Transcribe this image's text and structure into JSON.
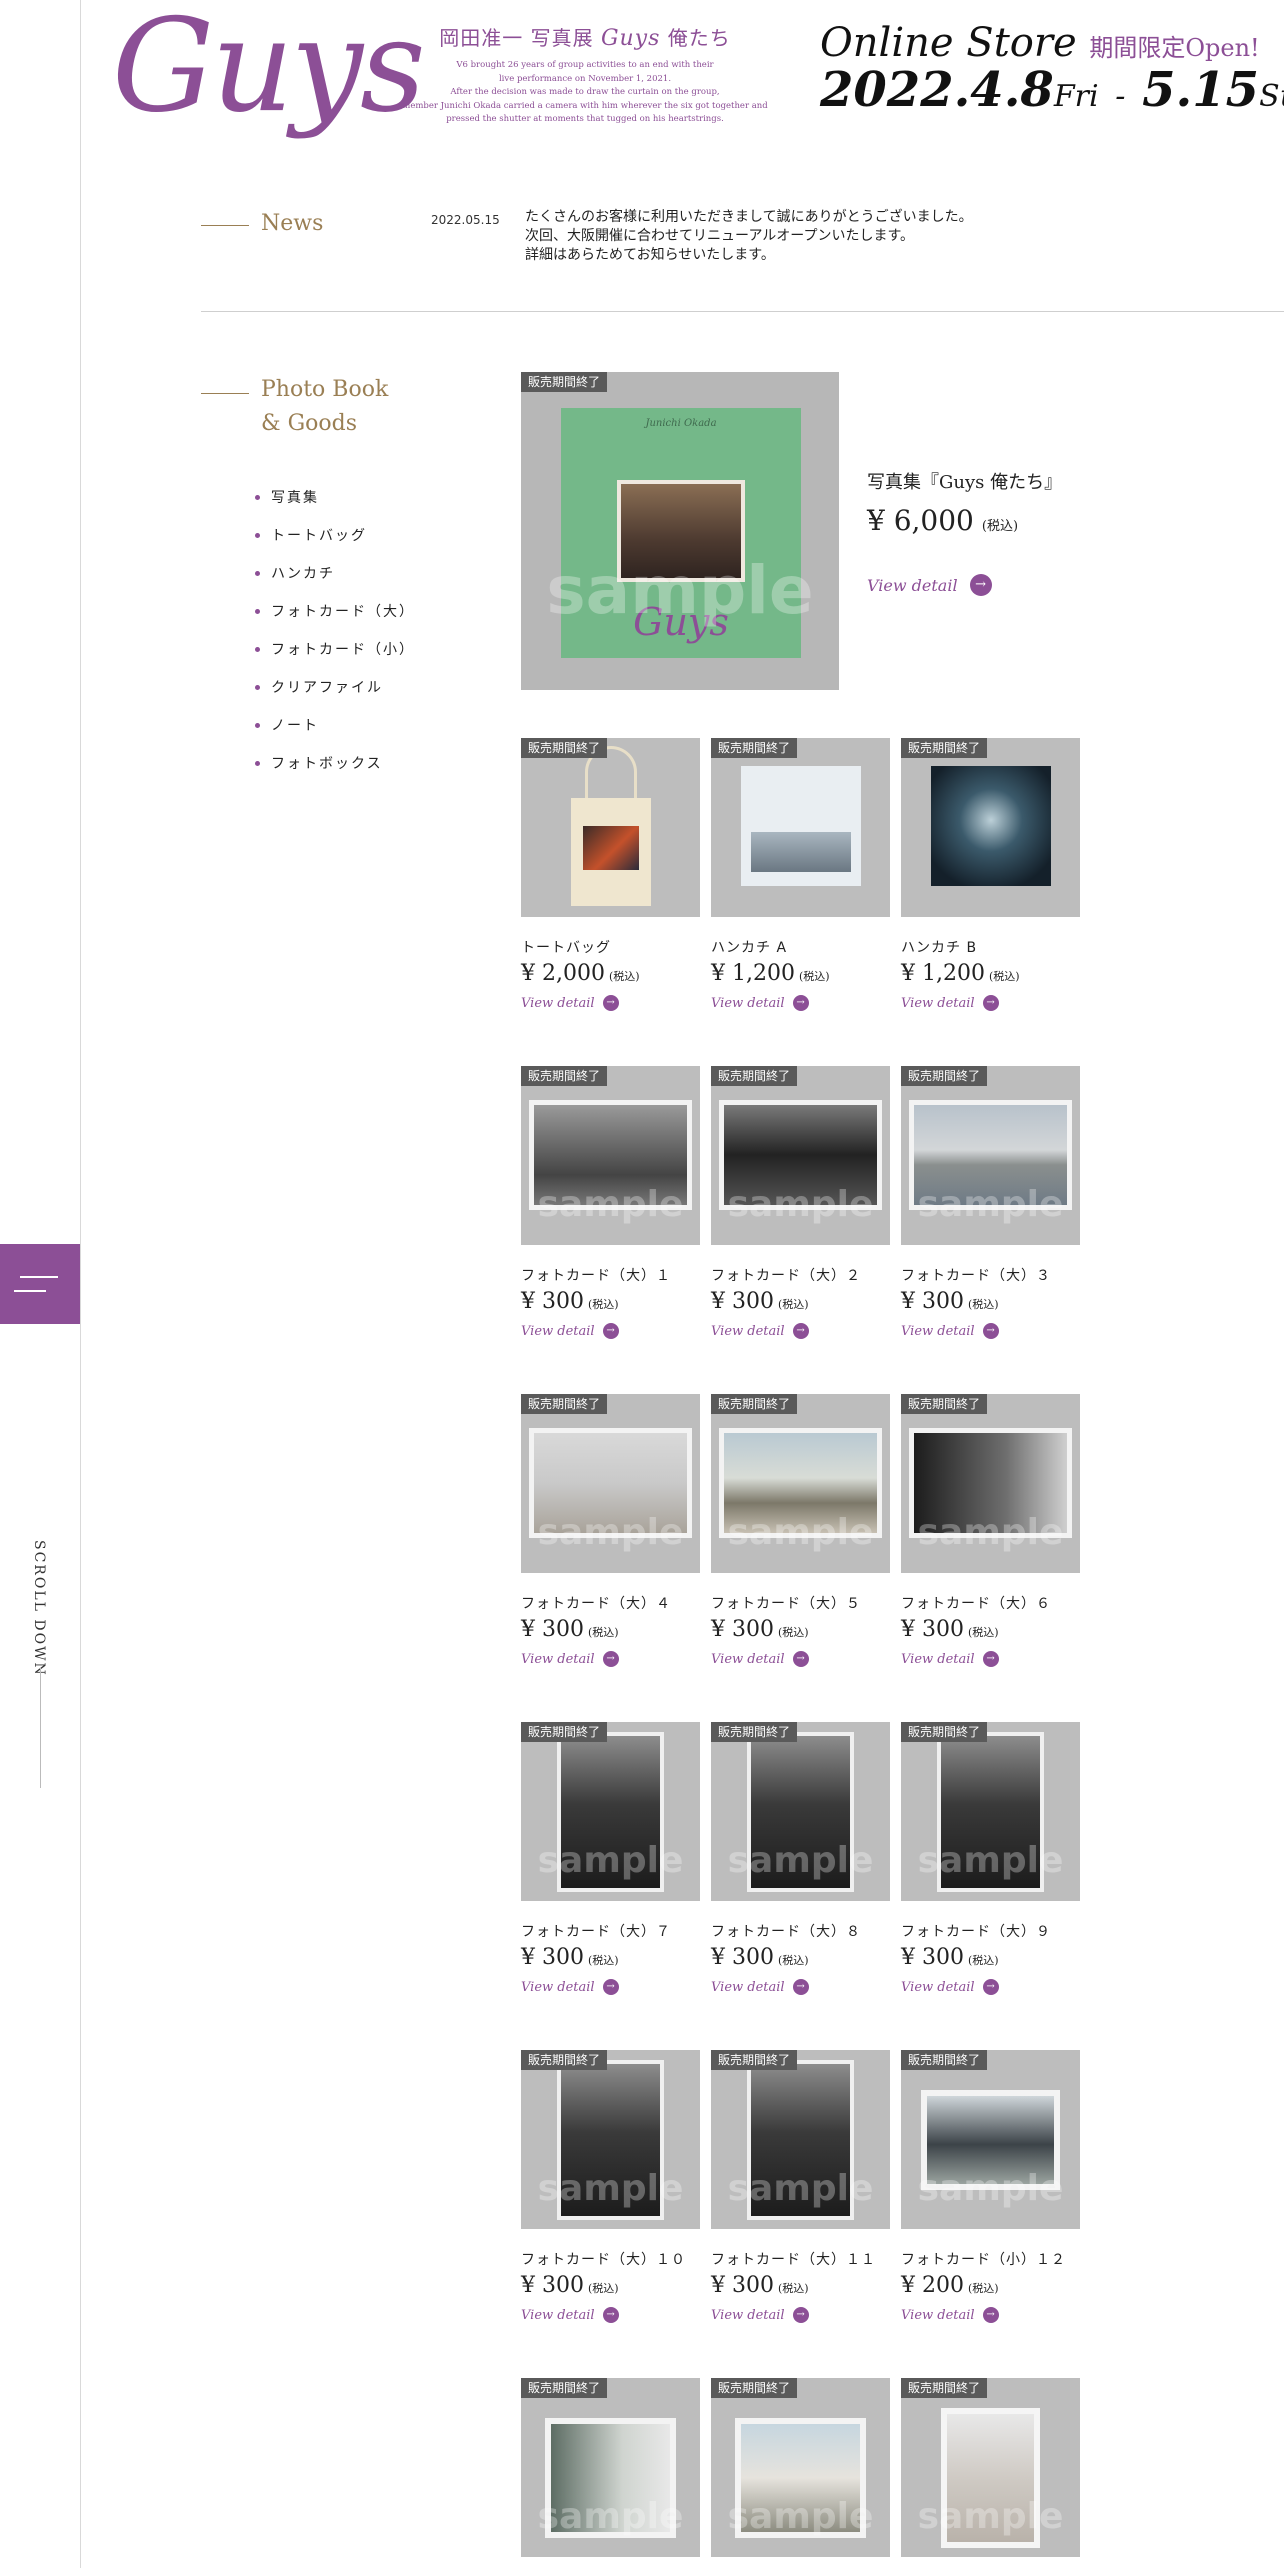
{
  "header": {
    "logo": "Guys",
    "exhibition_title": "岡田准一 写真展",
    "exhibition_title_en": "Guys",
    "exhibition_title_suffix": "俺たち",
    "description_lines": [
      "V6 brought 26 years of group activities to an end with their",
      "live performance on November 1, 2021.",
      "After the decision was made to draw the curtain on the group,",
      "member Junichi Okada carried a camera with him wherever the six got together and",
      "pressed the shutter at moments that tugged on his heartstrings."
    ],
    "store_label": "Online Store",
    "store_limited": "期間限定Open!",
    "date_start": "2022.4.8",
    "day_start": "Fri",
    "date_sep": "-",
    "date_end": "5.15",
    "day_end": "Sun"
  },
  "news": {
    "label": "News",
    "date": "2022.05.15",
    "body": "たくさんのお客様に利用いただきまして誠にありがとうございました。\n次回、大阪開催に合わせてリニューアルオープンいたします。\n詳細はあらためてお知らせいたします。"
  },
  "goods": {
    "label_line1": "Photo Book",
    "label_line2": "& Goods",
    "categories": [
      "写真集",
      "トートバッグ",
      "ハンカチ",
      "フォトカード（大）",
      "フォトカード（小）",
      "クリアファイル",
      "ノート",
      "フォトボックス"
    ]
  },
  "badge_text": "販売期間終了",
  "watermark_text": "sample",
  "view_detail": "View detail",
  "tax_label": "(税込)",
  "featured": {
    "name": "写真集『Guys 俺たち』",
    "price": "¥ 6,000",
    "book_author": "Junichi Okada",
    "book_title": "Guys"
  },
  "book_cover_text": "Guys",
  "products": [
    {
      "name": "トートバッグ",
      "price": "¥ 2,000"
    },
    {
      "name": "ハンカチ A",
      "price": "¥ 1,200"
    },
    {
      "name": "ハンカチ B",
      "price": "¥ 1,200"
    },
    {
      "name": "フォトカード（大）１",
      "price": "¥ 300"
    },
    {
      "name": "フォトカード（大）２",
      "price": "¥ 300"
    },
    {
      "name": "フォトカード（大）３",
      "price": "¥ 300"
    },
    {
      "name": "フォトカード（大）４",
      "price": "¥ 300"
    },
    {
      "name": "フォトカード（大）５",
      "price": "¥ 300"
    },
    {
      "name": "フォトカード（大）６",
      "price": "¥ 300"
    },
    {
      "name": "フォトカード（大）７",
      "price": "¥ 300"
    },
    {
      "name": "フォトカード（大）８",
      "price": "¥ 300"
    },
    {
      "name": "フォトカード（大）９",
      "price": "¥ 300"
    },
    {
      "name": "フォトカード（大）１０",
      "price": "¥ 300"
    },
    {
      "name": "フォトカード（大）１１",
      "price": "¥ 300"
    },
    {
      "name": "フォトカード（小）１２",
      "price": "¥ 200"
    }
  ],
  "scroll_label": "SCROLL DOWN",
  "colors": {
    "accent": "#8c4f96",
    "gold": "#9a7f54",
    "badge": "#5a5a5a"
  }
}
